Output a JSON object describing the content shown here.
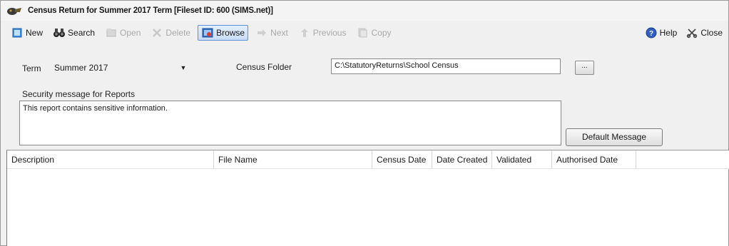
{
  "window": {
    "title": "Census Return for Summer 2017 Term [Fileset ID: 600 (SIMS.net)]"
  },
  "toolbar": {
    "new_label": "New",
    "search_label": "Search",
    "open_label": "Open",
    "delete_label": "Delete",
    "browse_label": "Browse",
    "next_label": "Next",
    "previous_label": "Previous",
    "copy_label": "Copy",
    "help_label": "Help",
    "close_label": "Close"
  },
  "form": {
    "term_label": "Term",
    "term_value": "Summer 2017",
    "census_folder_label": "Census Folder",
    "census_folder_value": "C:\\StatutoryReturns\\School Census",
    "browse_button_label": "...",
    "security_message_label": "Security message for Reports",
    "security_message_value": "This report contains sensitive information.",
    "default_message_button": "Default Message"
  },
  "grid": {
    "columns": [
      "Description",
      "File Name",
      "Census Date",
      "Date Created",
      "Validated",
      "Authorised Date"
    ],
    "rows": []
  },
  "colors": {
    "window_bg": "#f0f0f0",
    "active_button_border": "#5b8fd6",
    "disabled_text": "#a9a9a9"
  }
}
